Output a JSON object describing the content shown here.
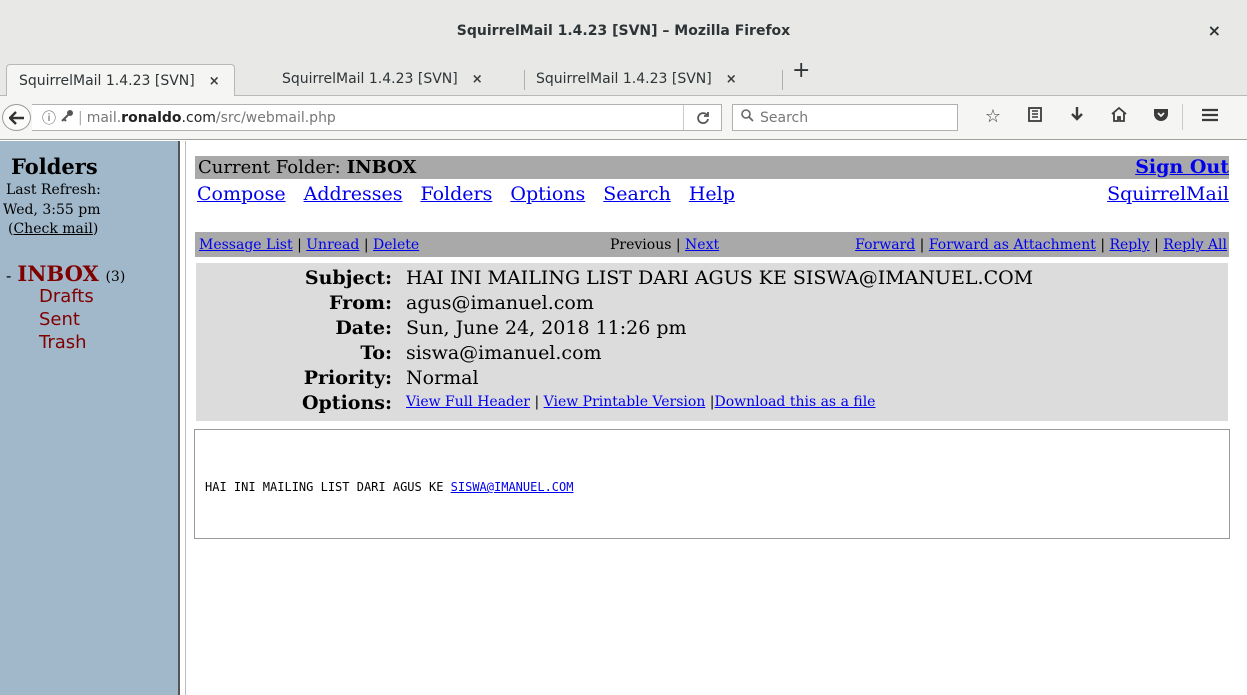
{
  "window": {
    "title": "SquirrelMail 1.4.23 [SVN] – Mozilla Firefox",
    "close_glyph": "×"
  },
  "tabs": [
    {
      "label": "SquirrelMail 1.4.23 [SVN]",
      "active": true,
      "close_glyph": "×"
    },
    {
      "label": "SquirrelMail 1.4.23 [SVN]",
      "active": false,
      "close_glyph": "×"
    },
    {
      "label": "SquirrelMail 1.4.23 [SVN]",
      "active": false,
      "close_glyph": "×"
    }
  ],
  "new_tab_glyph": "+",
  "navbar": {
    "url_host_prefix": "mail.",
    "url_host_bold": "ronaldo",
    "url_host_suffix": ".com",
    "url_path": "/src/webmail.php",
    "search_placeholder": "Search",
    "icons": [
      "bookmark-star-icon",
      "reading-list-icon",
      "download-icon",
      "home-icon",
      "pocket-icon",
      "menu-icon"
    ]
  },
  "sidebar": {
    "heading": "Folders",
    "last_refresh_label": "Last Refresh:",
    "last_refresh_value": "Wed, 3:55 pm",
    "check_mail_open": "(",
    "check_mail": "Check mail",
    "check_mail_close": ")",
    "inbox_dash": "-",
    "inbox_label": "INBOX",
    "inbox_count": "(3)",
    "folders": [
      "Drafts",
      "Sent",
      "Trash"
    ],
    "folder_color": "#800000",
    "background": "#a1b8cb"
  },
  "main": {
    "current_folder_label": "Current Folder:",
    "current_folder_value": "INBOX",
    "sign_out": "Sign Out",
    "menu": [
      "Compose",
      "Addresses",
      "Folders",
      "Options",
      "Search",
      "Help"
    ],
    "brand_link": "SquirrelMail",
    "message_nav": {
      "message_list": "Message List",
      "unread": "Unread",
      "delete": "Delete",
      "previous": "Previous",
      "next": "Next",
      "forward": "Forward",
      "forward_attachment": "Forward as Attachment",
      "reply": "Reply",
      "reply_all": "Reply All",
      "separator": "|"
    },
    "headers": [
      {
        "key": "Subject:",
        "value": "HAI INI MAILING LIST DARI AGUS KE SISWA@IMANUEL.COM"
      },
      {
        "key": "From:",
        "value": "agus@imanuel.com"
      },
      {
        "key": "Date:",
        "value": "Sun, June 24, 2018 11:26 pm"
      },
      {
        "key": "To:",
        "value": "siswa@imanuel.com"
      },
      {
        "key": "Priority:",
        "value": "Normal"
      }
    ],
    "options_label": "Options:",
    "options": {
      "view_full_header": "View Full Header",
      "view_printable": "View Printable Version",
      "download": "Download this as a file",
      "separator": "|"
    },
    "body_text": "HAI INI MAILING LIST DARI AGUS KE",
    "body_link": "SISWA@IMANUEL.COM"
  },
  "colors": {
    "link": "#0000ee",
    "bar_gray": "#a9a9a9",
    "header_box": "#dcdcdc"
  }
}
